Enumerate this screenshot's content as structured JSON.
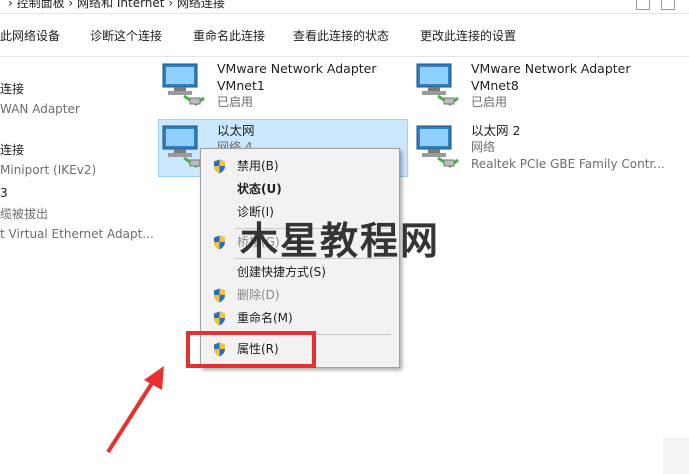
{
  "breadcrumb": {
    "path": "› 控制面板 › 网络和 Internet › 网络连接"
  },
  "toolbar": {
    "items": [
      "此网络设备",
      "诊断这个连接",
      "重命名此连接",
      "查看此连接的状态",
      "更改此连接的设置"
    ]
  },
  "left_partial": [
    {
      "line1": "连接",
      "line2": "WAN Adapter"
    },
    {
      "line1": "连接",
      "line2": "Miniport (IKEv2)"
    },
    {
      "line1": "3",
      "line2": "缆被拔出"
    },
    {
      "line1": "t Virtual Ethernet Adapt..."
    }
  ],
  "adapters": [
    {
      "name": "VMware Network Adapter",
      "name2": "VMnet1",
      "status": "已启用"
    },
    {
      "name": "VMware Network Adapter",
      "name2": "VMnet8",
      "status": "已启用"
    },
    {
      "name": "以太网",
      "status": "网络 4"
    },
    {
      "name": "以太网 2",
      "status": "网络",
      "device": "Realtek PCIe GBE Family Contr..."
    }
  ],
  "context_menu": {
    "items": [
      {
        "label": "禁用(B)"
      },
      {
        "label": "状态(U)"
      },
      {
        "label": "诊断(I)"
      },
      {
        "label": "桥接(G)"
      },
      {
        "label": "创建快捷方式(S)"
      },
      {
        "label": "删除(D)"
      },
      {
        "label": "重命名(M)"
      },
      {
        "label": "属性(R)"
      }
    ]
  },
  "watermark": {
    "text": "木星教程网"
  },
  "colors": {
    "highlight": "#e8312f",
    "selection": "#cce8ff",
    "selection_border": "#99d1ff"
  }
}
